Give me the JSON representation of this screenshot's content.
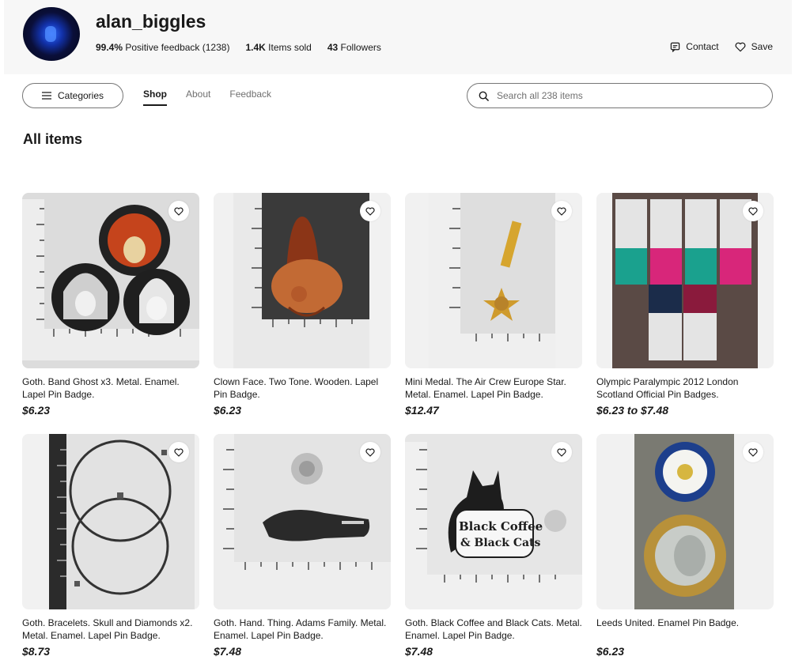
{
  "seller": {
    "name": "alan_biggles",
    "feedback_pct": "99.4%",
    "feedback_text": "Positive feedback (1238)",
    "items_sold": "1.4K",
    "items_sold_label": "Items sold",
    "followers": "43",
    "followers_label": "Followers"
  },
  "header_actions": {
    "contact": "Contact",
    "save": "Save"
  },
  "nav": {
    "categories_label": "Categories",
    "tabs": [
      {
        "label": "Shop",
        "active": true
      },
      {
        "label": "About",
        "active": false
      },
      {
        "label": "Feedback",
        "active": false
      }
    ]
  },
  "search": {
    "placeholder": "Search all 238 items",
    "value": ""
  },
  "section_title": "All items",
  "icons": {
    "menu": "hamburger-icon",
    "search": "search-icon",
    "contact": "message-icon",
    "save": "heart-icon",
    "favorite": "heart-icon"
  },
  "items": [
    {
      "title": "Goth. Band Ghost x3. Metal. Enamel. Lapel Pin Badge.",
      "price": "$6.23"
    },
    {
      "title": "Clown Face. Two Tone. Wooden. Lapel Pin Badge.",
      "price": "$6.23"
    },
    {
      "title": "Mini Medal. The Air Crew Europe Star. Metal. Enamel. Lapel Pin Badge.",
      "price": "$12.47"
    },
    {
      "title": "Olympic Paralympic 2012 London Scotland Official Pin Badges.",
      "price": "$6.23 to $7.48"
    },
    {
      "title": "Goth. Bracelets. Skull and Diamonds x2. Metal. Enamel. Lapel Pin Badge.",
      "price": "$8.73"
    },
    {
      "title": "Goth. Hand. Thing. Adams Family. Metal. Enamel. Lapel Pin Badge.",
      "price": "$7.48"
    },
    {
      "title": "Goth. Black Coffee and Black Cats. Metal. Enamel. Lapel Pin Badge.",
      "price": "$7.48"
    },
    {
      "title": "Leeds United. Enamel Pin Badge.",
      "price": "$6.23"
    }
  ],
  "image_text": {
    "coffee_line1": "Black Coffee",
    "coffee_line2": "& Black Cats"
  }
}
